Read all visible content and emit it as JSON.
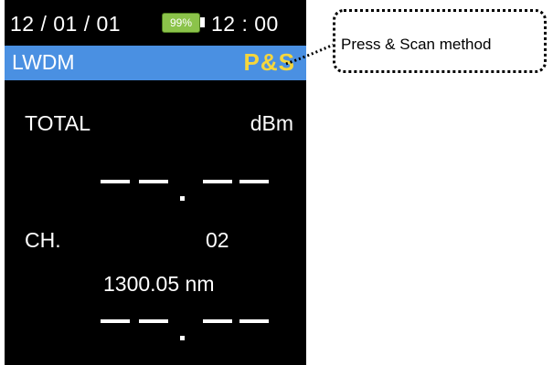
{
  "status": {
    "date": "12 / 01 / 01",
    "battery": "99%",
    "battery_color": "#8bc34a",
    "time": "12 : 00"
  },
  "mode_bar": {
    "mode": "LWDM",
    "method": "P&S",
    "bar_color": "#4a90e2",
    "method_color": "#f5d63d"
  },
  "total": {
    "label": "TOTAL",
    "unit": "dBm"
  },
  "channel": {
    "label": "CH.",
    "value": "02",
    "wavelength": "1300.05 nm"
  },
  "callout": {
    "text": "Press & Scan method"
  }
}
